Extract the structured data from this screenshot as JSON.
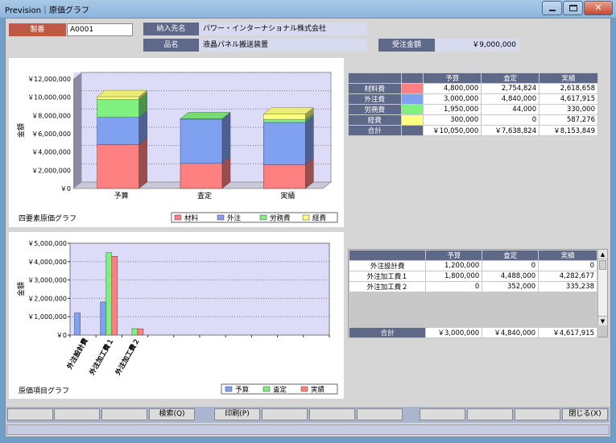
{
  "window": {
    "title": "Prevision｜原価グラフ"
  },
  "header": {
    "seiban_label": "製番",
    "seiban_value": "A0001",
    "customer_label": "納入先名",
    "customer_value": "パワー・インターナショナル株式会社",
    "product_label": "品名",
    "product_value": "液晶パネル搬送装置",
    "order_label": "受注金額",
    "order_value": "￥9,000,000"
  },
  "summary_table": {
    "columns": [
      "予算",
      "査定",
      "実績"
    ],
    "rows": [
      {
        "label": "材料費",
        "color": "#ff8080",
        "values": [
          "4,800,000",
          "2,754,824",
          "2,618,658"
        ]
      },
      {
        "label": "外注費",
        "color": "#80a0f0",
        "values": [
          "3,000,000",
          "4,840,000",
          "4,617,915"
        ]
      },
      {
        "label": "労務費",
        "color": "#80f080",
        "values": [
          "1,950,000",
          "44,000",
          "330,000"
        ]
      },
      {
        "label": "経費",
        "color": "#ffff80",
        "values": [
          "300,000",
          "0",
          "587,276"
        ]
      }
    ],
    "total": {
      "label": "合計",
      "values": [
        "￥10,050,000",
        "￥7,638,824",
        "￥8,153,849"
      ]
    }
  },
  "items_table": {
    "columns": [
      "予算",
      "査定",
      "実績"
    ],
    "rows": [
      {
        "label": "外注設計費",
        "values": [
          "1,200,000",
          "0",
          "0"
        ]
      },
      {
        "label": "外注加工費１",
        "values": [
          "1,800,000",
          "4,488,000",
          "4,282,677"
        ]
      },
      {
        "label": "外注加工費２",
        "values": [
          "0",
          "352,000",
          "335,238"
        ]
      }
    ],
    "total": {
      "label": "合計",
      "values": [
        "￥3,000,000",
        "￥4,840,000",
        "￥4,617,915"
      ]
    }
  },
  "chart_data": [
    {
      "type": "bar",
      "stacked": true,
      "caption": "四要素原価グラフ",
      "ylabel": "金額",
      "categories": [
        "予算",
        "査定",
        "実績"
      ],
      "ylim": [
        0,
        12000000
      ],
      "yticks": [
        "￥0",
        "￥2,000,000",
        "￥4,000,000",
        "￥6,000,000",
        "￥8,000,000",
        "￥10,000,000",
        "￥12,000,000"
      ],
      "series": [
        {
          "name": "材料",
          "color": "#ff8080",
          "values": [
            4800000,
            2754824,
            2618658
          ]
        },
        {
          "name": "外注",
          "color": "#80a0f0",
          "values": [
            3000000,
            4840000,
            4617915
          ]
        },
        {
          "name": "労務費",
          "color": "#80f080",
          "values": [
            1950000,
            44000,
            330000
          ]
        },
        {
          "name": "経費",
          "color": "#ffff80",
          "values": [
            300000,
            0,
            587276
          ]
        }
      ]
    },
    {
      "type": "bar",
      "caption": "原価項目グラフ",
      "ylabel": "金額",
      "categories": [
        "外注設計費",
        "外注加工費１",
        "外注加工費２"
      ],
      "ylim": [
        0,
        5000000
      ],
      "yticks": [
        "￥0",
        "￥1,000,000",
        "￥2,000,000",
        "￥3,000,000",
        "￥4,000,000",
        "￥5,000,000"
      ],
      "series": [
        {
          "name": "予算",
          "color": "#80a0f0",
          "values": [
            1200000,
            1800000,
            0
          ]
        },
        {
          "name": "査定",
          "color": "#80f080",
          "values": [
            0,
            4488000,
            352000
          ]
        },
        {
          "name": "実績",
          "color": "#ff8080",
          "values": [
            0,
            4282677,
            335238
          ]
        }
      ]
    }
  ],
  "function_keys": {
    "search": "検索(Q)",
    "print": "印刷(P)",
    "close": "閉じる(X)"
  }
}
